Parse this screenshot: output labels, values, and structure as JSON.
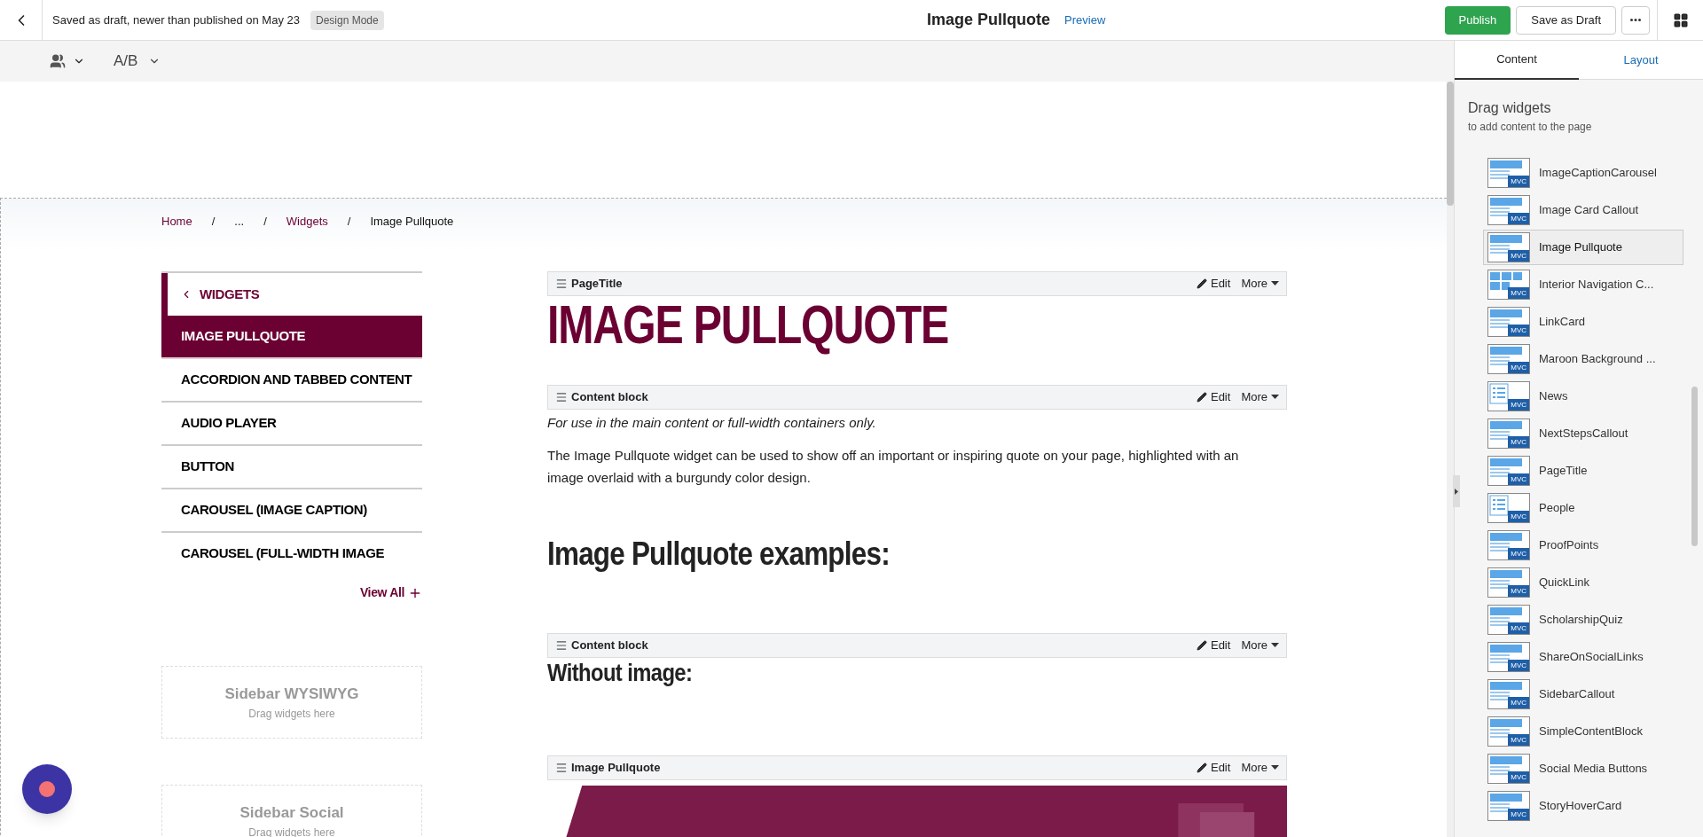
{
  "topbar": {
    "status": "Saved as draft, newer than published on May 23",
    "mode_badge": "Design Mode",
    "title": "Image Pullquote",
    "preview_link": "Preview",
    "publish": "Publish",
    "save_draft": "Save as Draft"
  },
  "toolbar": {
    "ab_label": "A/B"
  },
  "panel": {
    "tabs": [
      {
        "label": "Content",
        "selected": true
      },
      {
        "label": "Layout",
        "selected": false
      }
    ],
    "heading": "Drag widgets",
    "subheading": "to add content to the page",
    "widgets": [
      {
        "name": "ImageCaptionCarousel",
        "kind": "banner",
        "selected": false,
        "badge": "MVC"
      },
      {
        "name": "Image Card Callout",
        "kind": "banner",
        "selected": false,
        "badge": "MVC"
      },
      {
        "name": "Image Pullquote",
        "kind": "banner",
        "selected": true,
        "badge": "MVC"
      },
      {
        "name": "Interior Navigation C...",
        "kind": "grid",
        "selected": false,
        "badge": "MVC"
      },
      {
        "name": "LinkCard",
        "kind": "banner",
        "selected": false,
        "badge": "MVC"
      },
      {
        "name": "Maroon Background ...",
        "kind": "banner",
        "selected": false,
        "badge": "MVC"
      },
      {
        "name": "News",
        "kind": "list",
        "selected": false,
        "badge": "MVC"
      },
      {
        "name": "NextStepsCallout",
        "kind": "banner",
        "selected": false,
        "badge": "MVC"
      },
      {
        "name": "PageTitle",
        "kind": "banner",
        "selected": false,
        "badge": "MVC"
      },
      {
        "name": "People",
        "kind": "list",
        "selected": false,
        "badge": "MVC"
      },
      {
        "name": "ProofPoints",
        "kind": "banner",
        "selected": false,
        "badge": "MVC"
      },
      {
        "name": "QuickLink",
        "kind": "banner",
        "selected": false,
        "badge": "MVC"
      },
      {
        "name": "ScholarshipQuiz",
        "kind": "banner",
        "selected": false,
        "badge": "MVC"
      },
      {
        "name": "ShareOnSocialLinks",
        "kind": "banner",
        "selected": false,
        "badge": "MVC"
      },
      {
        "name": "SidebarCallout",
        "kind": "banner",
        "selected": false,
        "badge": "MVC"
      },
      {
        "name": "SimpleContentBlock",
        "kind": "banner",
        "selected": false,
        "badge": "MVC"
      },
      {
        "name": "Social Media Buttons",
        "kind": "banner",
        "selected": false,
        "badge": "MVC"
      },
      {
        "name": "StoryHoverCard",
        "kind": "banner",
        "selected": false,
        "badge": "MVC"
      }
    ]
  },
  "breadcrumb": [
    {
      "label": "Home",
      "link": true
    },
    {
      "label": "...",
      "link": false
    },
    {
      "label": "Widgets",
      "link": true
    },
    {
      "label": "Image Pullquote",
      "link": false
    }
  ],
  "breadcrumb_separators": [
    "/",
    "/",
    "/"
  ],
  "sidenav": {
    "back": "WIDGETS",
    "items": [
      {
        "label": "IMAGE PULLQUOTE",
        "selected": true
      },
      {
        "label": "ACCORDION AND TABBED CONTENT",
        "selected": false
      },
      {
        "label": "AUDIO PLAYER",
        "selected": false
      },
      {
        "label": "BUTTON",
        "selected": false
      },
      {
        "label": "CAROUSEL (IMAGE CAPTION)",
        "selected": false
      },
      {
        "label": "CAROUSEL (FULL-WIDTH IMAGE",
        "selected": false
      }
    ],
    "view_all": "View All"
  },
  "placeholders": [
    {
      "title": "Sidebar WYSIWYG",
      "hint": "Drag widgets here"
    },
    {
      "title": "Sidebar Social",
      "hint": "Drag widgets here"
    }
  ],
  "blocks": [
    {
      "kind": "title",
      "bar": "PageTitle",
      "edit": "Edit",
      "more": "More",
      "text": "IMAGE PULLQUOTE"
    },
    {
      "kind": "content",
      "bar": "Content block",
      "edit": "Edit",
      "more": "More",
      "note": "For use in the main content or full-width containers only.",
      "paragraph": "The Image Pullquote widget can be used to show off an important or inspiring quote on your page, highlighted with an image overlaid with a burgundy color design.",
      "heading": "Image Pullquote examples:"
    },
    {
      "kind": "subheading",
      "bar": "Content block",
      "edit": "Edit",
      "more": "More",
      "text": "Without image:"
    },
    {
      "kind": "pullquote",
      "bar": "Image Pullquote",
      "edit": "Edit",
      "more": "More"
    }
  ]
}
